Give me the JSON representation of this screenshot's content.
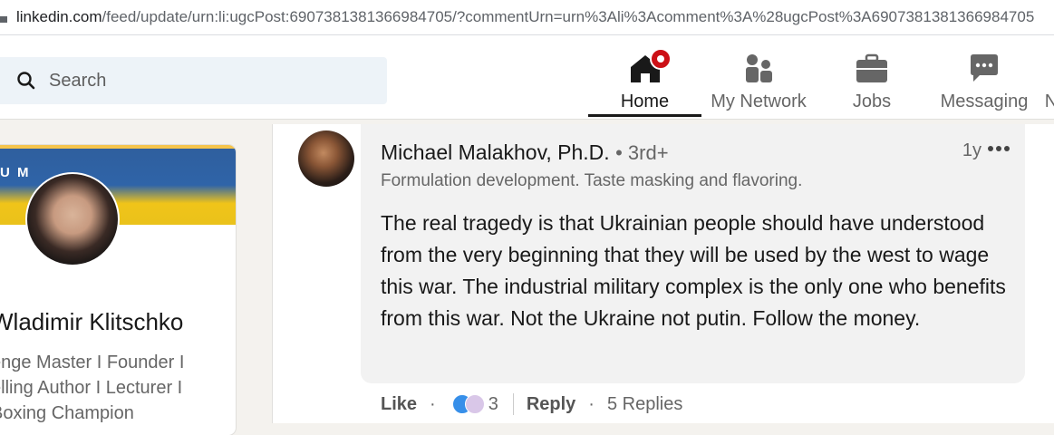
{
  "browser": {
    "url_host": "linkedin.com",
    "url_path": "/feed/update/urn:li:ugcPost:6907381381366984705/?commentUrn=urn%3Ali%3Acomment%3A%28ugcPost%3A6907381381366984705"
  },
  "nav": {
    "search_placeholder": "Search",
    "items": [
      {
        "label": "Home",
        "icon": "home-icon",
        "active": true,
        "notification": true
      },
      {
        "label": "My Network",
        "icon": "people-icon"
      },
      {
        "label": "Jobs",
        "icon": "briefcase-icon"
      },
      {
        "label": "Messaging",
        "icon": "chat-icon"
      }
    ]
  },
  "profile": {
    "banner_text": "U M",
    "name": "Wladimir Klitschko",
    "headline": "enge Master I Founder I\nelling Author I Lecturer I\nBoxing Champion"
  },
  "comment": {
    "author": "Michael Malakhov, Ph.D.",
    "degree": "• 3rd+",
    "headline": "Formulation development. Taste masking and flavoring.",
    "time": "1y",
    "text": "The real tragedy is that Ukrainian people should have understood from the very beginning that they will be used by the west to wage this war. The industrial military complex is the only one who benefits from this war. Not the Ukraine not putin. Follow the money.",
    "actions": {
      "like": "Like",
      "dot1": "·",
      "reaction_count": "3",
      "reply": "Reply",
      "dot2": "·",
      "replies": "5 Replies"
    }
  },
  "colors": {
    "active": "#191919",
    "muted": "#666666",
    "notification": "#cc1016",
    "like_blue": "#378fe9"
  }
}
